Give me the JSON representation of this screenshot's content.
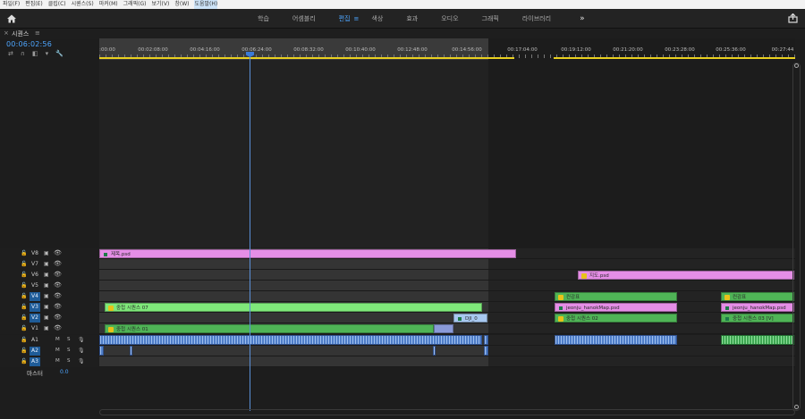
{
  "menubar": {
    "items": [
      "파일(F)",
      "편집(E)",
      "클립(C)",
      "시퀀스(S)",
      "마커(M)",
      "그래픽(G)",
      "보기(V)",
      "창(W)",
      "도움말(H)"
    ]
  },
  "workspace": {
    "tabs": [
      "학습",
      "어셈블리",
      "편집",
      "색상",
      "효과",
      "오디오",
      "그래픽",
      "라이브러리"
    ],
    "active_tab": "편집",
    "menu_glyph": "≡",
    "more_glyph": "»"
  },
  "panel": {
    "close": "×",
    "title": "시퀀스",
    "menu": "≡",
    "timecode": "00:06:02:56"
  },
  "tools": [
    "⇄",
    "∩",
    "◧",
    "▾",
    "🔧"
  ],
  "ruler": {
    "labels": [
      ":00:00",
      "00:02:08:00",
      "00:04:16:00",
      "00:06:24:00",
      "00:08:32:00",
      "00:10:40:00",
      "00:12:48:00",
      "00:14:56:00",
      "00:17:04:00",
      "00:19:12:00",
      "00:21:20:00",
      "00:23:28:00",
      "00:25:36:00",
      "00:27:44"
    ]
  },
  "tracks": [
    {
      "name": "V8",
      "on": false
    },
    {
      "name": "V7",
      "on": false
    },
    {
      "name": "V6",
      "on": false
    },
    {
      "name": "V5",
      "on": false
    },
    {
      "name": "V4",
      "on": true
    },
    {
      "name": "V3",
      "on": true
    },
    {
      "name": "V2",
      "on": true
    },
    {
      "name": "V1",
      "on": false
    },
    {
      "name": "A1",
      "on": false
    },
    {
      "name": "A2",
      "on": true
    },
    {
      "name": "A3",
      "on": true
    }
  ],
  "audio_buttons": {
    "m": "M",
    "s": "S"
  },
  "clips": {
    "v8_title": "제목.psd",
    "v6_map": "지도.psd",
    "v3_nested": "중첩 시퀀스 07",
    "v2_dji": "DJI_0",
    "v1_nested": "중첩 시퀀스 01",
    "v4_block1": "컨감표",
    "v3_block1": "jeonju_hanokMap.psd",
    "v2_block1": "중첩 시퀀스 02",
    "v4_block2": "컨감표",
    "v3_block2": "jeonju_hanokMap.psd",
    "v2_block2": "중첩 시퀀스 03 [V]"
  },
  "master": {
    "label": "마스터",
    "value": "0.0"
  },
  "colors": {
    "accent": "#4ea6ff",
    "pink_clip": "#e58ee6",
    "green_clip": "#4fb456",
    "lime_clip": "#7fe87a",
    "audio_blue": "#4f7ec8",
    "yellow_bar": "#e8d020"
  }
}
